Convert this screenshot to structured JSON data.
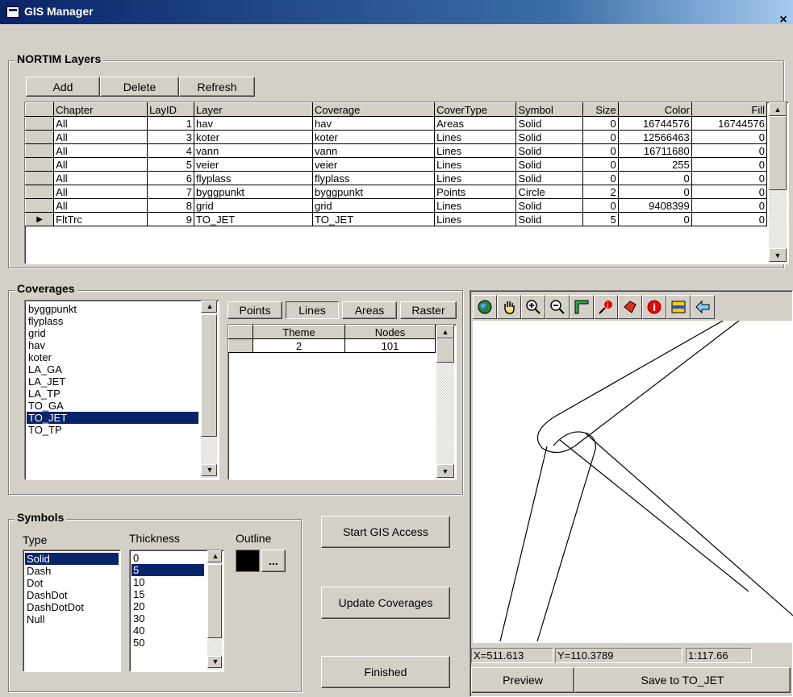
{
  "window": {
    "title": "GIS Manager",
    "close": "×"
  },
  "layers": {
    "group_title": "NORTIM Layers",
    "buttons": {
      "add": "Add",
      "delete": "Delete",
      "refresh": "Refresh"
    },
    "columns": [
      "Chapter",
      "LayID",
      "Layer",
      "Coverage",
      "CoverType",
      "Symbol",
      "Size",
      "Color",
      "Fill"
    ],
    "rows": [
      {
        "chapter": "All",
        "layid": "1",
        "layer": "hav",
        "coverage": "hav",
        "covertype": "Areas",
        "symbol": "Solid",
        "size": "0",
        "color": "16744576",
        "fill": "16744576"
      },
      {
        "chapter": "All",
        "layid": "3",
        "layer": "koter",
        "coverage": "koter",
        "covertype": "Lines",
        "symbol": "Solid",
        "size": "0",
        "color": "12566463",
        "fill": "0"
      },
      {
        "chapter": "All",
        "layid": "4",
        "layer": "vann",
        "coverage": "vann",
        "covertype": "Lines",
        "symbol": "Solid",
        "size": "0",
        "color": "16711680",
        "fill": "0"
      },
      {
        "chapter": "All",
        "layid": "5",
        "layer": "veier",
        "coverage": "veier",
        "covertype": "Lines",
        "symbol": "Solid",
        "size": "0",
        "color": "255",
        "fill": "0"
      },
      {
        "chapter": "All",
        "layid": "6",
        "layer": "flyplass",
        "coverage": "flyplass",
        "covertype": "Lines",
        "symbol": "Solid",
        "size": "0",
        "color": "0",
        "fill": "0"
      },
      {
        "chapter": "All",
        "layid": "7",
        "layer": "byggpunkt",
        "coverage": "byggpunkt",
        "covertype": "Points",
        "symbol": "Circle",
        "size": "2",
        "color": "0",
        "fill": "0"
      },
      {
        "chapter": "All",
        "layid": "8",
        "layer": "grid",
        "coverage": "grid",
        "covertype": "Lines",
        "symbol": "Solid",
        "size": "0",
        "color": "9408399",
        "fill": "0"
      },
      {
        "chapter": "FltTrc",
        "layid": "9",
        "layer": "TO_JET",
        "coverage": "TO_JET",
        "covertype": "Lines",
        "symbol": "Solid",
        "size": "5",
        "color": "0",
        "fill": "0"
      }
    ]
  },
  "coverages": {
    "group_title": "Coverages",
    "items": [
      "byggpunkt",
      "flyplass",
      "grid",
      "hav",
      "koter",
      "LA_GA",
      "LA_JET",
      "LA_TP",
      "TO_GA",
      "TO_JET",
      "TO_TP"
    ],
    "selected": "TO_JET",
    "tabs": [
      "Points",
      "Lines",
      "Areas",
      "Raster"
    ],
    "active_tab": "Lines",
    "theme_columns": [
      "Theme",
      "Nodes"
    ],
    "theme_rows": [
      {
        "theme": "2",
        "nodes": "101"
      }
    ]
  },
  "symbols": {
    "group_title": "Symbols",
    "type_label": "Type",
    "thickness_label": "Thickness",
    "outline_label": "Outline",
    "outline_button": "...",
    "types": [
      "Solid",
      "Dash",
      "Dot",
      "DashDot",
      "DashDotDot",
      "Null"
    ],
    "selected_type": "Solid",
    "thickness": [
      "0",
      "5",
      "10",
      "15",
      "20",
      "30",
      "40",
      "50"
    ],
    "selected_thickness": "5",
    "outline_color": "#000000"
  },
  "actions": {
    "start": "Start GIS Access",
    "update": "Update Coverages",
    "finished": "Finished"
  },
  "map": {
    "tools": [
      "globe-icon",
      "hand-pan-icon",
      "zoom-in-icon",
      "zoom-out-icon",
      "measure-icon",
      "identify-icon",
      "select-icon",
      "info-icon",
      "layers-icon",
      "back-arrow-icon"
    ],
    "status": {
      "x": "X=511.613",
      "y": "Y=110.3789",
      "scale": "1:117.66"
    },
    "preview": "Preview",
    "save": "Save to TO_JET"
  },
  "colors": {
    "selection": "#0a246a",
    "face": "#d4d0c8",
    "title_start": "#0a246a"
  }
}
